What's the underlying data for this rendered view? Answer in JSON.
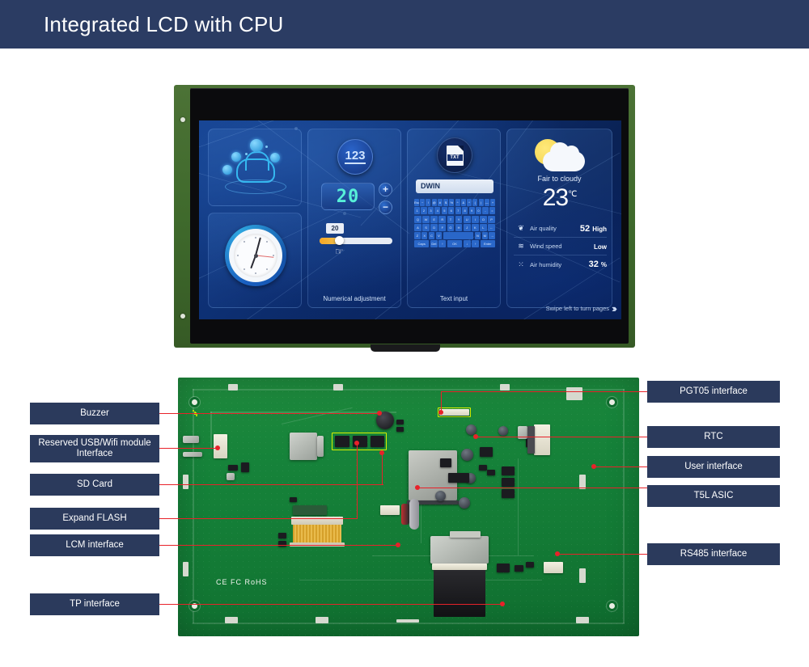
{
  "header": {
    "title": "Integrated LCD with CPU"
  },
  "lcd": {
    "panels": {
      "iot": {
        "caption": ""
      },
      "clock": {
        "caption": ""
      },
      "numeric": {
        "badge": "123",
        "value": "20",
        "plus": "+",
        "minus": "−",
        "slider_value": "20",
        "caption": "Numerical adjustment"
      },
      "text_input": {
        "badge": "TXT",
        "field_value": "DWIN",
        "caption": "Text input",
        "keyboard": [
          [
            "Esc",
            "~",
            "!",
            "@",
            "#",
            "$",
            "%",
            "^",
            "&",
            "*",
            "(",
            ")",
            "—",
            "+"
          ],
          [
            "1",
            "2",
            "3",
            "4",
            "5",
            "6",
            "7",
            "8",
            "9",
            "0",
            "-",
            "="
          ],
          [
            "Q",
            "W",
            "E",
            "R",
            "T",
            "Y",
            "U",
            "I",
            "O",
            "P"
          ],
          [
            "A",
            "S",
            "D",
            "F",
            "G",
            "H",
            "J",
            "K",
            "L",
            "←"
          ],
          [
            "Z",
            "X",
            "C",
            "V",
            "B",
            "N",
            "M",
            "→"
          ],
          [
            "Caps Lock",
            "Del",
            "↑",
            "OK",
            "↓",
            "↑",
            "Enter"
          ]
        ]
      },
      "weather": {
        "condition": "Fair to cloudy",
        "temperature": "23",
        "temp_unit": "℃",
        "rows": [
          {
            "icon": "leaf-icon",
            "label": "Air quality",
            "value": "52",
            "value_suffix": "High"
          },
          {
            "icon": "wind-icon",
            "label": "Wind speed",
            "value": "",
            "value_suffix": "Low"
          },
          {
            "icon": "humidity-icon",
            "label": "Air humidity",
            "value": "32",
            "value_suffix": "%"
          }
        ]
      }
    },
    "swipe_hint": "Swipe left to turn pages",
    "swipe_chevrons": "›››"
  },
  "pcb": {
    "certification_marks": "CE  FC  RoHS",
    "left_labels": [
      {
        "id": "buzzer",
        "text": "Buzzer"
      },
      {
        "id": "usb-wifi",
        "text": "Reserved USB/Wifi module Interface"
      },
      {
        "id": "sd-card",
        "text": "SD Card"
      },
      {
        "id": "expand-flash",
        "text": "Expand FLASH"
      },
      {
        "id": "lcm",
        "text": "LCM interface"
      },
      {
        "id": "tp",
        "text": "TP interface"
      }
    ],
    "right_labels": [
      {
        "id": "pgt05",
        "text": "PGT05 interface"
      },
      {
        "id": "rtc",
        "text": "RTC"
      },
      {
        "id": "user",
        "text": "User interface"
      },
      {
        "id": "t5l",
        "text": "T5L ASIC"
      },
      {
        "id": "rs485",
        "text": "RS485 interface"
      }
    ]
  },
  "colors": {
    "header_bg": "#2b3c63",
    "label_bg": "#2b3a5c",
    "lead_line": "#e8222a",
    "pcb_green": "#16833a",
    "screen_blue": "#0d2f72"
  }
}
